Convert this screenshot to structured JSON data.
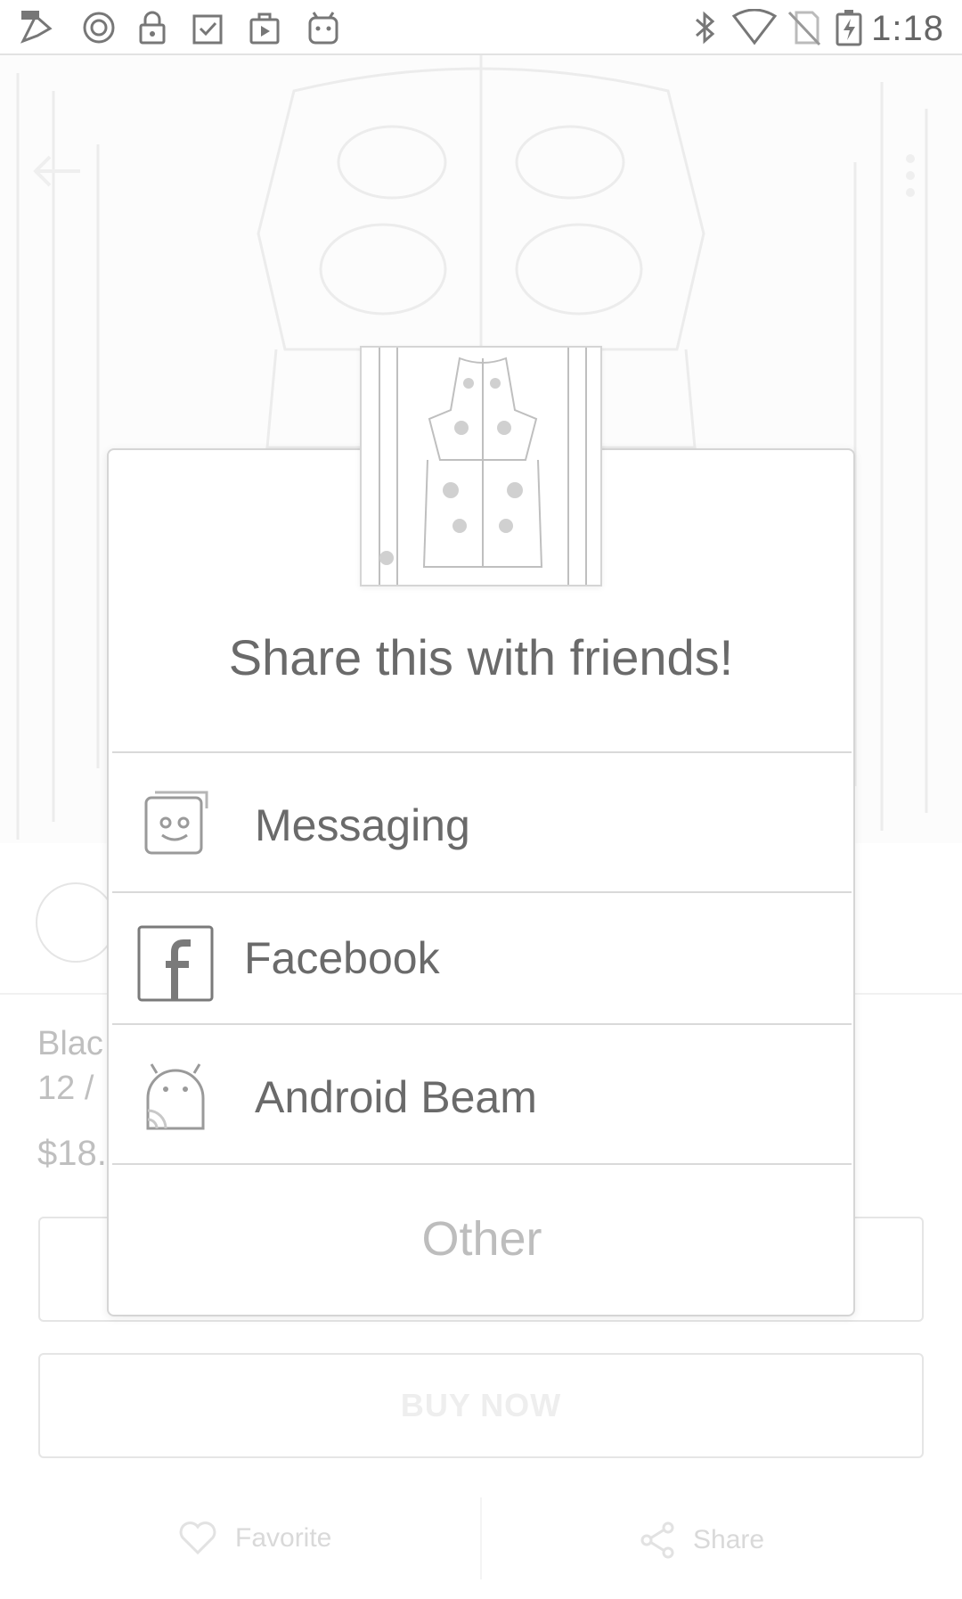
{
  "status_bar": {
    "time": "1:18",
    "icons": [
      "galaxy-apps-icon",
      "notification-icon",
      "lock-icon",
      "clipboard-check-icon",
      "play-bag-icon",
      "android-icon",
      "bluetooth-icon",
      "wifi-icon",
      "no-sim-icon",
      "battery-charging-icon"
    ]
  },
  "product": {
    "title": "Blac",
    "size": "12 / ",
    "price": "$18."
  },
  "buttons": {
    "buy_now": "BUY NOW"
  },
  "bottom_bar": {
    "favorite": "Favorite",
    "share": "Share"
  },
  "dialog": {
    "title": "Share this with friends!",
    "options": [
      {
        "label": "Messaging",
        "icon": "messaging-icon"
      },
      {
        "label": "Facebook",
        "icon": "facebook-icon"
      },
      {
        "label": "Android Beam",
        "icon": "android-beam-icon"
      },
      {
        "label": "Other",
        "icon": ""
      }
    ]
  },
  "colors": {
    "dialog_border": "#d5d5d5",
    "text": "#6a6a6a",
    "muted": "#bdbdbd"
  }
}
